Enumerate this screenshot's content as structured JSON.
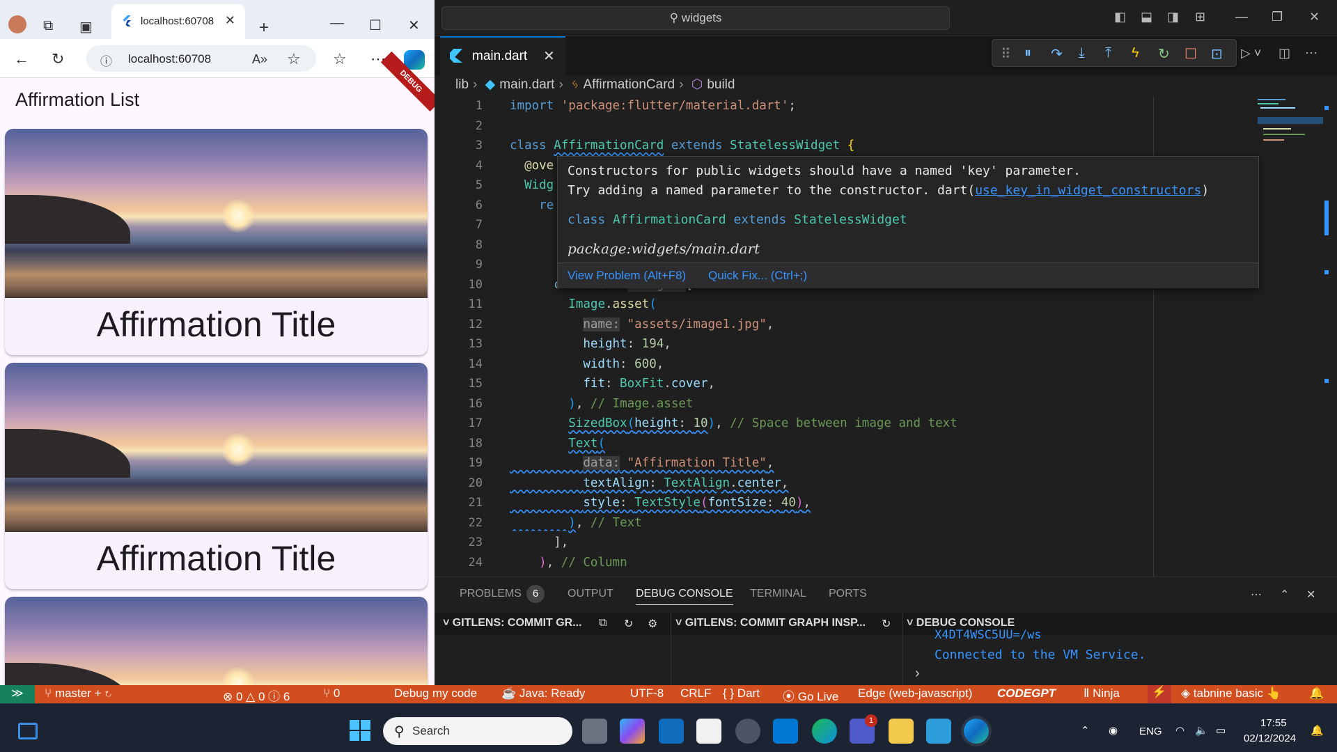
{
  "browser": {
    "tab_title": "localhost:60708",
    "address": "localhost:60708",
    "app_bar_title": "Affirmation List",
    "debug_banner": "DEBUG",
    "cards": [
      {
        "caption": "Affirmation Title"
      },
      {
        "caption": "Affirmation Title"
      },
      {
        "caption": ""
      }
    ]
  },
  "vscode": {
    "search": "widgets",
    "tab": {
      "label": "main.dart"
    },
    "breadcrumb": [
      "lib",
      "main.dart",
      "AffirmationCard",
      "build"
    ],
    "line_numbers": [
      "1",
      "2",
      "3",
      "4",
      "5",
      "6",
      "7",
      "8",
      "9",
      "10",
      "11",
      "12",
      "13",
      "14",
      "15",
      "16",
      "17",
      "18",
      "19",
      "20",
      "21",
      "22",
      "23",
      "24"
    ],
    "hover": {
      "message_line1": "Constructors for public widgets should have a named 'key' parameter.",
      "message_line2": "Try adding a named parameter to the constructor. dart(",
      "rule_link": "use_key_in_widget_constructors",
      "rule_close": ")",
      "signature_kw1": "class",
      "signature_name": "AffirmationCard",
      "signature_kw2": "extends",
      "signature_base": "StatelessWidget",
      "package": "package:widgets/main.dart",
      "view_problem": "View Problem (Alt+F8)",
      "quick_fix": "Quick Fix... (Ctrl+;)"
    },
    "panel": {
      "tabs": [
        "PROBLEMS",
        "OUTPUT",
        "DEBUG CONSOLE",
        "TERMINAL",
        "PORTS"
      ],
      "problems_count": "6",
      "active_tab": "DEBUG CONSOLE",
      "sections": [
        "GITLENS: COMMIT GR...",
        "GITLENS: COMMIT GRAPH INSP...",
        "DEBUG CONSOLE"
      ],
      "debug_output_partial": "X4DT4WSC5UU=/ws",
      "debug_output": "Connected to the VM Service."
    },
    "status_bar": {
      "branch": "master +",
      "problems": "⊗ 0 △ 0 ⓘ 6",
      "ports": "⑂ 0",
      "debug": "Debug my code",
      "java": "Java: Ready",
      "encoding": "UTF-8",
      "eol": "CRLF",
      "language": "{ } Dart",
      "go_live": "Go Live",
      "device": "Edge (web-javascript)",
      "codegpt": "CODEGPT",
      "ninja": "Ninja",
      "tabnine": "tabnine basic"
    },
    "accent": "#0078d4",
    "status_color": "#d34e1f"
  },
  "taskbar": {
    "search_placeholder": "Search",
    "lang": "ENG",
    "time": "17:55",
    "date": "02/12/2024",
    "teams_badge": "1"
  }
}
